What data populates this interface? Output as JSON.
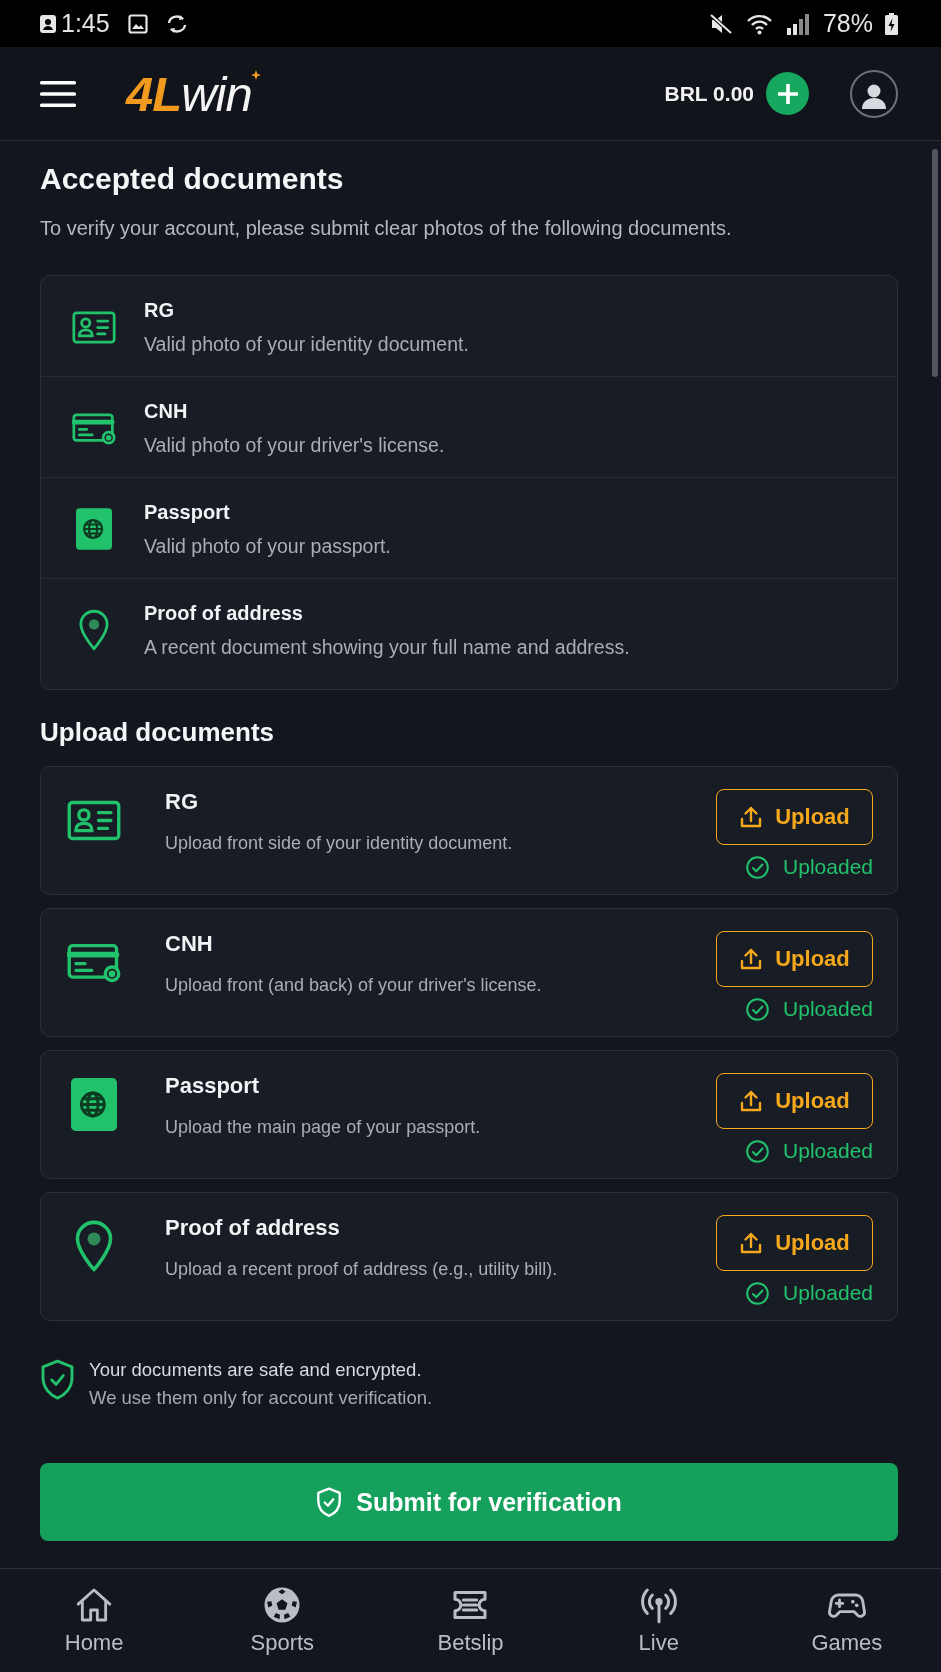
{
  "status_bar": {
    "time": "1:45",
    "battery": "78%"
  },
  "header": {
    "logo": {
      "accent": "4L",
      "rest": "win"
    },
    "balance": "BRL 0.00"
  },
  "accepted": {
    "title": "Accepted documents",
    "subtitle": "To verify your account, please submit clear photos of the following documents.",
    "items": [
      {
        "kind": "id_card",
        "title": "RG",
        "description": "Valid photo of your identity document."
      },
      {
        "kind": "license",
        "title": "CNH",
        "description": "Valid photo of your driver's license."
      },
      {
        "kind": "passport",
        "title": "Passport",
        "description": "Valid photo of your passport."
      },
      {
        "kind": "address",
        "title": "Proof of address",
        "description": "A recent document showing your full name and address."
      }
    ]
  },
  "upload": {
    "title": "Upload documents",
    "items": [
      {
        "kind": "id_card",
        "title": "RG",
        "description": "Upload front side of your identity document.",
        "button": "Upload",
        "uploaded": true,
        "status": "Uploaded"
      },
      {
        "kind": "license",
        "title": "CNH",
        "description": "Upload front (and back) of your driver's license.",
        "button": "Upload",
        "uploaded": true,
        "status": "Uploaded"
      },
      {
        "kind": "passport",
        "title": "Passport",
        "description": "Upload the main page of your passport.",
        "button": "Upload",
        "uploaded": true,
        "status": "Uploaded"
      },
      {
        "kind": "address",
        "title": "Proof of address",
        "description": "Upload a recent proof of address (e.g., utility bill).",
        "button": "Upload",
        "uploaded": true,
        "status": "Uploaded"
      }
    ]
  },
  "security_note": {
    "lines": [
      "Your documents are safe and encrypted.",
      "We use them only for account verification."
    ]
  },
  "submit_button": "Submit for verification",
  "bottom_nav": [
    {
      "kind": "home",
      "label": "Home",
      "selected": false
    },
    {
      "kind": "sports",
      "label": "Sports",
      "selected": false
    },
    {
      "kind": "betslip",
      "label": "Betslip",
      "selected": false
    },
    {
      "kind": "live",
      "label": "Live",
      "selected": false
    },
    {
      "kind": "games",
      "label": "Games",
      "selected": false
    }
  ]
}
